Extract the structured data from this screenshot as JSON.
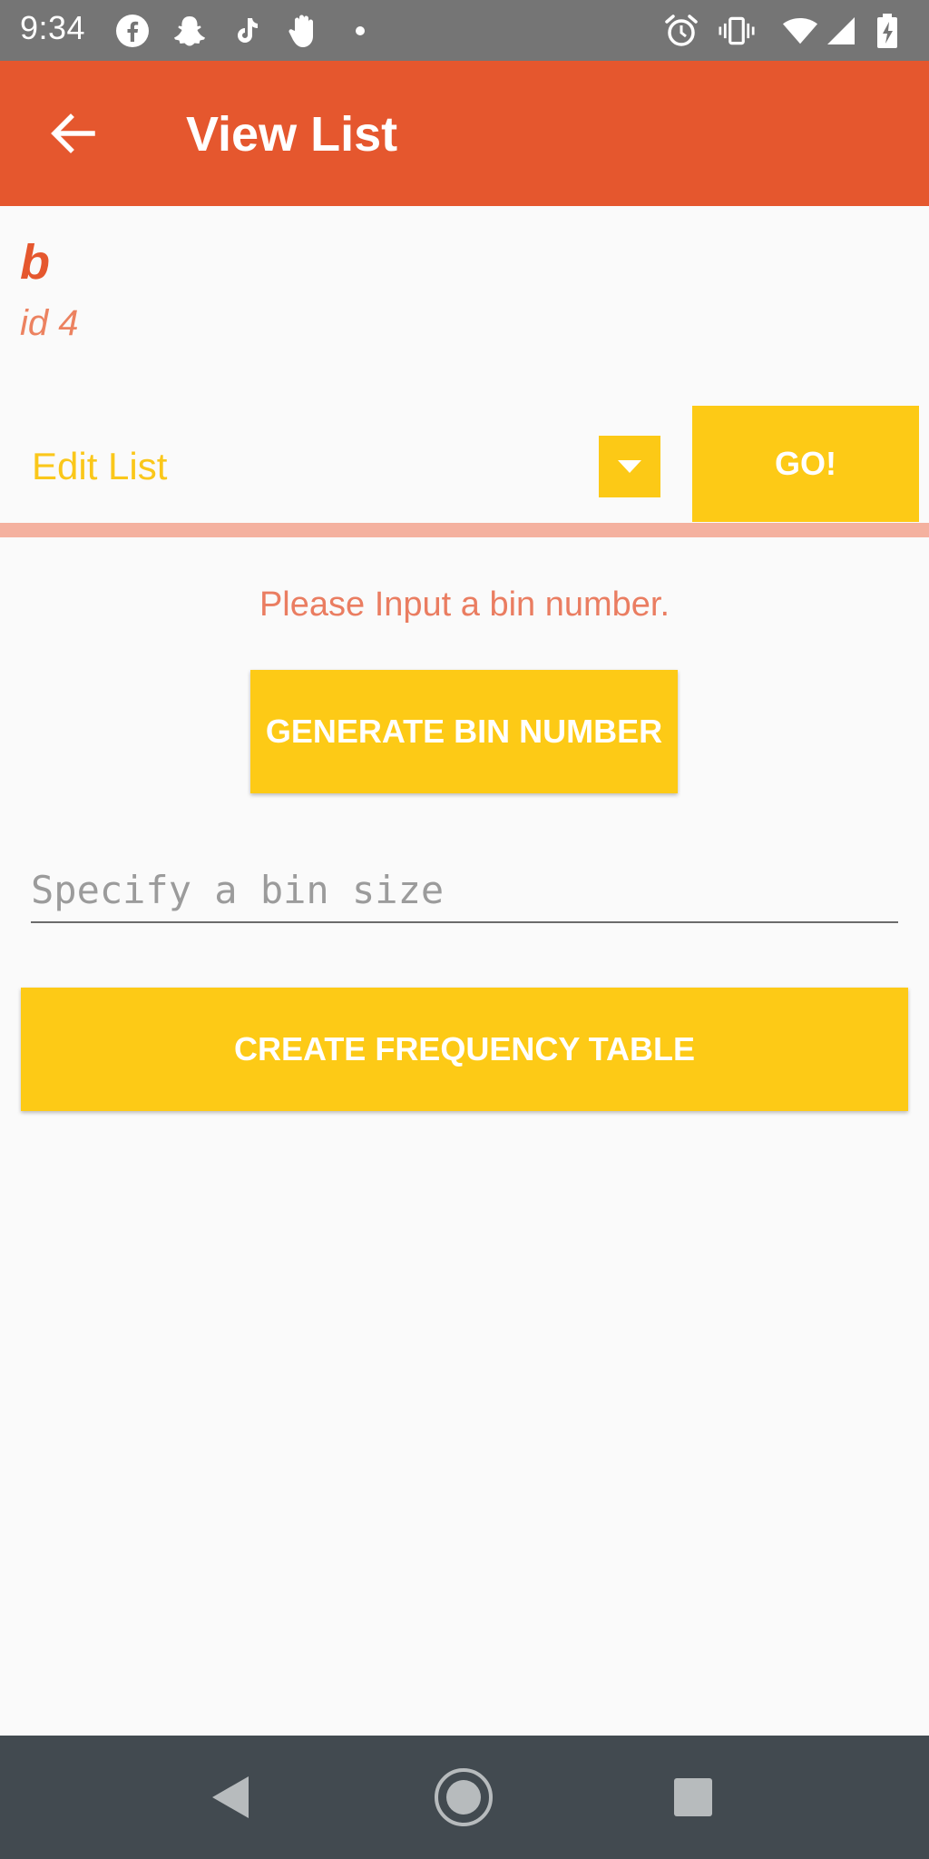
{
  "status_bar": {
    "time": "9:34",
    "left_icons": [
      "facebook-icon",
      "snapchat-icon",
      "tiktok-icon",
      "hand-icon",
      "dot-icon"
    ],
    "right_icons": [
      "alarm-icon",
      "vibrate-icon",
      "wifi-icon",
      "signal-icon",
      "battery-charging-icon"
    ]
  },
  "app_bar": {
    "title": "View List",
    "back_icon": "arrow-back-icon",
    "color": "#e5572e"
  },
  "list": {
    "name": "b",
    "id_label": "id 4"
  },
  "spinner": {
    "selected": "Edit List",
    "arrow_icon": "caret-down-icon"
  },
  "go_button": {
    "label": "GO!"
  },
  "prompt": {
    "text": "Please Input a bin number."
  },
  "generate_button": {
    "label": "GENERATE BIN NUMBER"
  },
  "bin_input": {
    "placeholder": "Specify a bin size",
    "value": ""
  },
  "frequency_button": {
    "label": "CREATE FREQUENCY TABLE"
  },
  "colors": {
    "accent": "#fdca16",
    "primary": "#e5572e",
    "divider": "#f4b19f"
  },
  "nav_bar": {
    "icons": [
      "nav-back-icon",
      "nav-home-icon",
      "nav-recents-icon"
    ]
  }
}
